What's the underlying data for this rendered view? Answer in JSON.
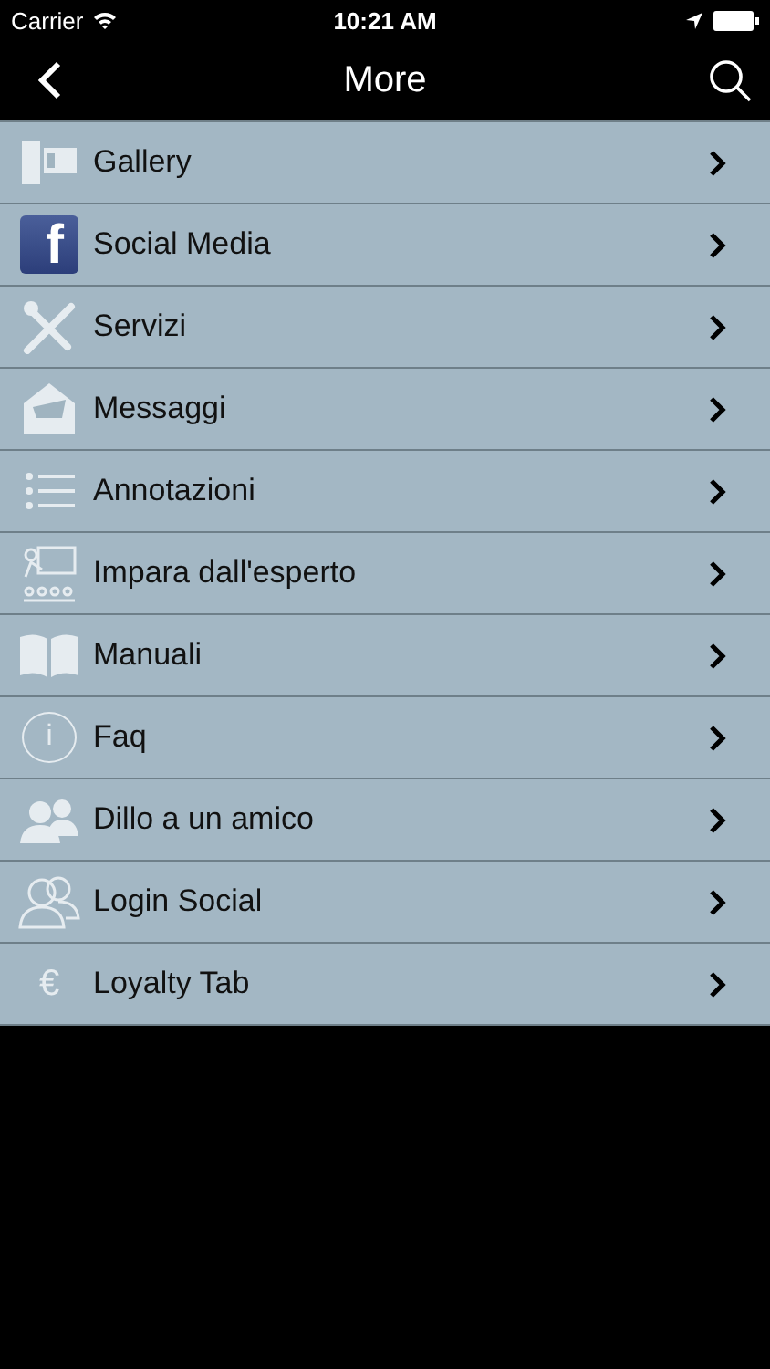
{
  "status_bar": {
    "carrier": "Carrier",
    "time": "10:21 AM"
  },
  "nav_bar": {
    "title": "More"
  },
  "items": [
    {
      "label": "Gallery",
      "kind": "film"
    },
    {
      "label": "Social Media",
      "kind": "facebook",
      "symbol": "f"
    },
    {
      "label": "Servizi",
      "kind": "tools"
    },
    {
      "label": "Messaggi",
      "kind": "envelope"
    },
    {
      "label": "Annotazioni",
      "kind": "list"
    },
    {
      "label": "Impara dall'esperto",
      "kind": "classroom"
    },
    {
      "label": "Manuali",
      "kind": "book"
    },
    {
      "label": "Faq",
      "kind": "info",
      "symbol": "i"
    },
    {
      "label": "Dillo a un amico",
      "kind": "people"
    },
    {
      "label": "Login Social",
      "kind": "people-outline"
    },
    {
      "label": "Loyalty Tab",
      "kind": "symbol",
      "symbol": "€"
    }
  ]
}
